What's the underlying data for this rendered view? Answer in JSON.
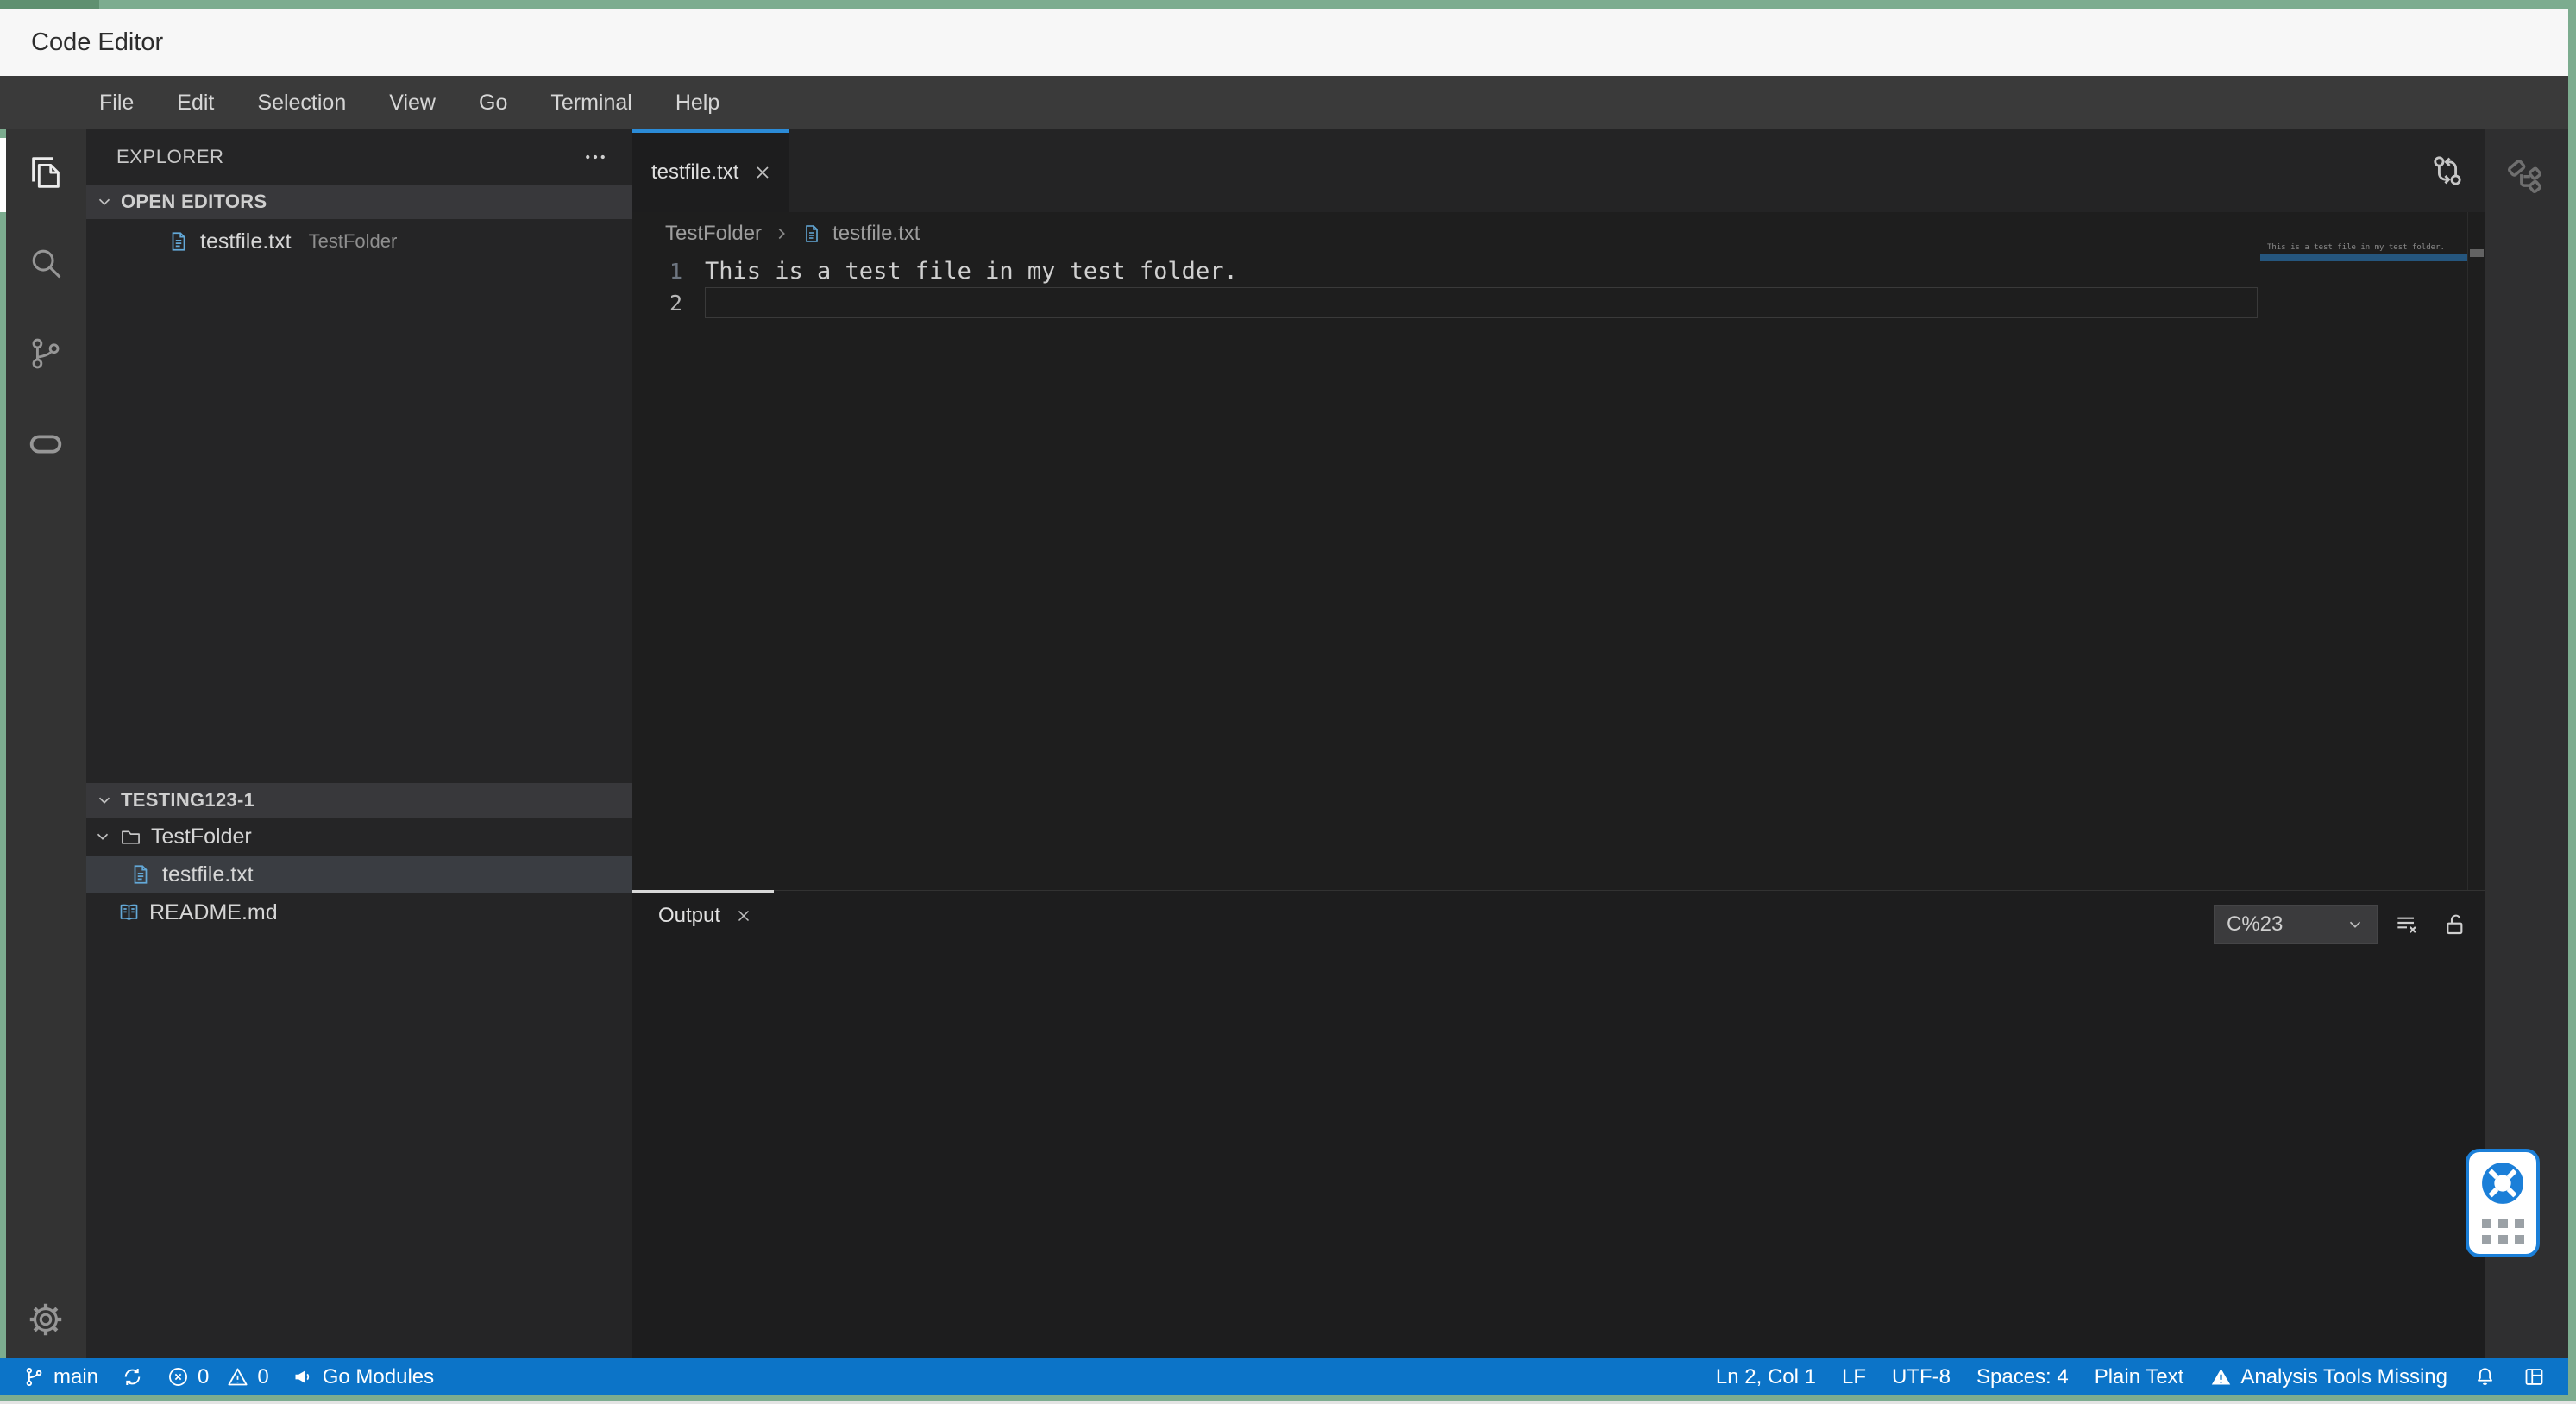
{
  "title_bar": {
    "title": "Code Editor"
  },
  "menu": {
    "items": [
      "File",
      "Edit",
      "Selection",
      "View",
      "Go",
      "Terminal",
      "Help"
    ]
  },
  "explorer": {
    "header": "EXPLORER",
    "open_editors": {
      "label": "OPEN EDITORS",
      "file": "testfile.txt",
      "detail": "TestFolder"
    },
    "workspace": {
      "label": "TESTING123-1",
      "folder": "TestFolder",
      "file": "testfile.txt",
      "readme": "README.md"
    }
  },
  "editor": {
    "tab": "testfile.txt",
    "breadcrumb": {
      "folder": "TestFolder",
      "file": "testfile.txt"
    },
    "lines": {
      "l1_no": "1",
      "l1_text": "This is a test file in my test folder.",
      "l2_no": "2",
      "l2_text": ""
    },
    "minimap_text": "This is a test file in my test folder."
  },
  "panel": {
    "tab": "Output",
    "channel": "C%23"
  },
  "status": {
    "branch": "main",
    "errors": "0",
    "warnings": "0",
    "modules": "Go Modules",
    "position": "Ln 2, Col 1",
    "eol": "LF",
    "encoding": "UTF-8",
    "spaces": "Spaces: 4",
    "language": "Plain Text",
    "analysis": "Analysis Tools Missing"
  },
  "colors": {
    "frame_green": "#7cac8f",
    "frame_green_dark": "#5f9070",
    "status_blue": "#0c74c8",
    "tab_accent": "#2b8bd7",
    "icon_blue": "#63a9d8",
    "helper_blue": "#1b7fd8",
    "minimap_highlight": "#25567e",
    "selection_row": "#3a3d42"
  }
}
